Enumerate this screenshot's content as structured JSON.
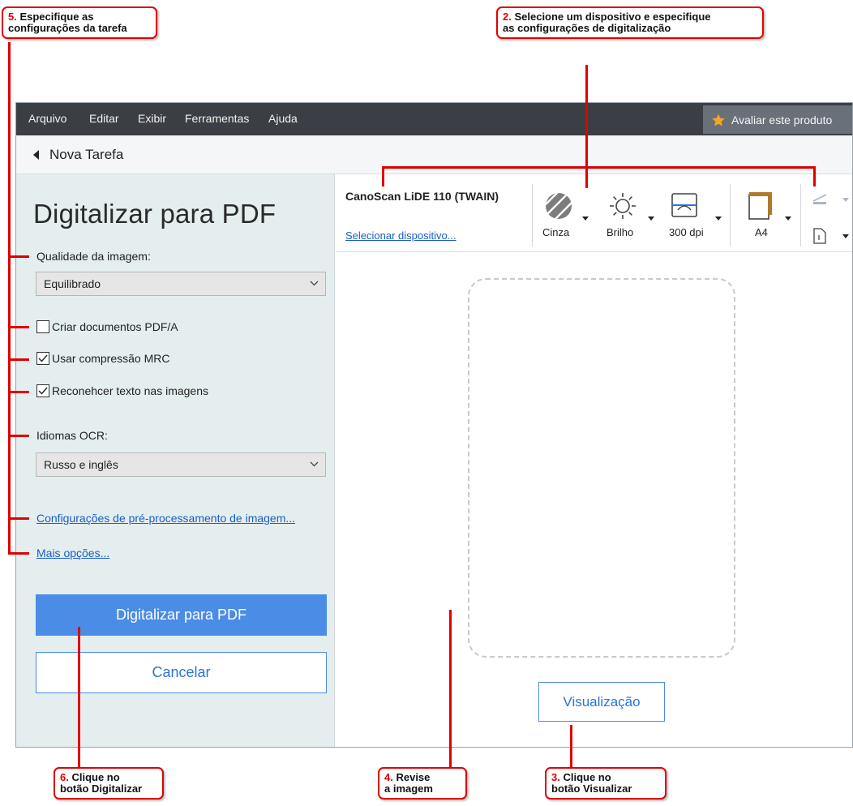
{
  "menu": {
    "items": [
      "Arquivo",
      "Editar",
      "Exibir",
      "Ferramentas",
      "Ajuda"
    ],
    "rate_label": "Avaliar este produto"
  },
  "nav": {
    "back_label": "Nova Tarefa"
  },
  "panel": {
    "title": "Digitalizar para PDF",
    "image_quality_label": "Qualidade da imagem:",
    "image_quality_value": "Equilibrado",
    "checkboxes": [
      {
        "label": "Criar documentos PDF/A",
        "checked": false
      },
      {
        "label": "Usar compressão MRC",
        "checked": true
      },
      {
        "label": "Reconehcer texto nas imagens",
        "checked": true
      }
    ],
    "ocr_label": "Idiomas OCR:",
    "ocr_value": "Russo e inglês",
    "preprocess_link": "Configurações de pré-processamento de imagem...",
    "more_link": "Mais opções...",
    "scan_button": "Digitalizar para PDF",
    "cancel_button": "Cancelar"
  },
  "toolbar": {
    "device_name": "CanoScan LiDE 110 (TWAIN)",
    "select_device_link": "Selecionar dispositivo...",
    "color_mode": "Cinza",
    "brightness": "Brilho",
    "resolution": "300 dpi",
    "paper_size": "A4"
  },
  "preview": {
    "button": "Visualização"
  },
  "annotations": {
    "step5_num": "5.",
    "step5_text_1": "Especifique as",
    "step5_text_2": "configurações da tarefa",
    "step2_num": "2.",
    "step2_text_1": "Selecione um dispositivo e especifique",
    "step2_text_2": "as configurações de digitalização",
    "step6_num": "6.",
    "step6_text_1": "Clique no",
    "step6_text_2": "botão Digitalizar",
    "step4_num": "4.",
    "step4_text_1": "Revise",
    "step4_text_2": "a imagem",
    "step3_num": "3.",
    "step3_text_1": "Clique no",
    "step3_text_2": "botão Visualizar"
  },
  "colors": {
    "accent": "#4b8ce6",
    "annotation": "#e00000",
    "menubar": "#3b3f45",
    "panel": "#e4eeef"
  }
}
